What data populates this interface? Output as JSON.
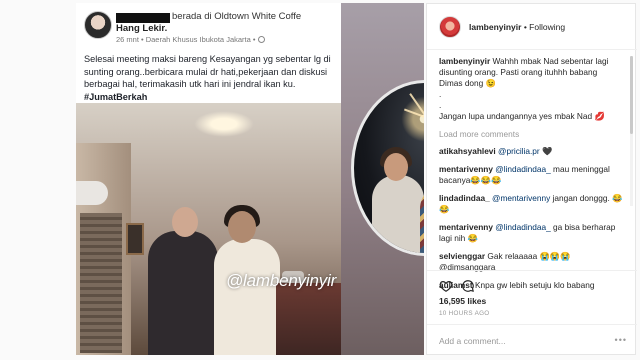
{
  "post_image": {
    "fb": {
      "line1_suffix": "berada di Oldtown White Coffe",
      "name": "Hang Lekir.",
      "meta": "26 mnt • Daerah Khusus Ibukota Jakarta • ",
      "caption": "Selesai meeting maksi bareng Kesayangan yg sebentar lg di sunting orang..berbicara mulai dr hati,pekerjaan dan diskusi berbagai hal, terimakasih utk hari ini jendral ikan ku.",
      "hashtag": "#JumatBerkah"
    },
    "watermark": "@lambenyinyir"
  },
  "panel": {
    "header": {
      "username": "lambenyinyir",
      "separator": "•",
      "follow_label": "Following"
    },
    "caption": {
      "username": "lambenyinyir",
      "text": " Wahhh mbak Nad sebentar lagi disunting orang. Pasti orang ituhhh babang Dimas dong 😉",
      "dot1": ".",
      "dot2": ".",
      "text2": "Jangan lupa undangannya yes mbak Nad 💋"
    },
    "load_more": "Load more comments",
    "comments": [
      {
        "user": "atikahsyahlevi",
        "mention": "@pricilia.pr",
        "text": " 🖤"
      },
      {
        "user": "mentarivenny",
        "mention": "@lindadindaa_",
        "text": " mau meninggal bacanya😂😂😂"
      },
      {
        "user": "lindadindaa_",
        "mention": "@mentarivenny",
        "text": " jangan donggg. 😂😂"
      },
      {
        "user": "mentarivenny",
        "mention": "@lindadindaa_",
        "text": " ga bisa berharap lagi nih 😂"
      },
      {
        "user": "selvienggar",
        "mention": "",
        "text": " Gak relaaaaa 😭😭😭 @dimsanggara"
      },
      {
        "user": "auliamst",
        "mention": "",
        "text": " Knpa gw lebih setuju klo babang"
      }
    ],
    "likes": "16,595 likes",
    "time_ago": "10 HOURS AGO",
    "add_comment_placeholder": "Add a comment...",
    "more_label": "•••"
  }
}
